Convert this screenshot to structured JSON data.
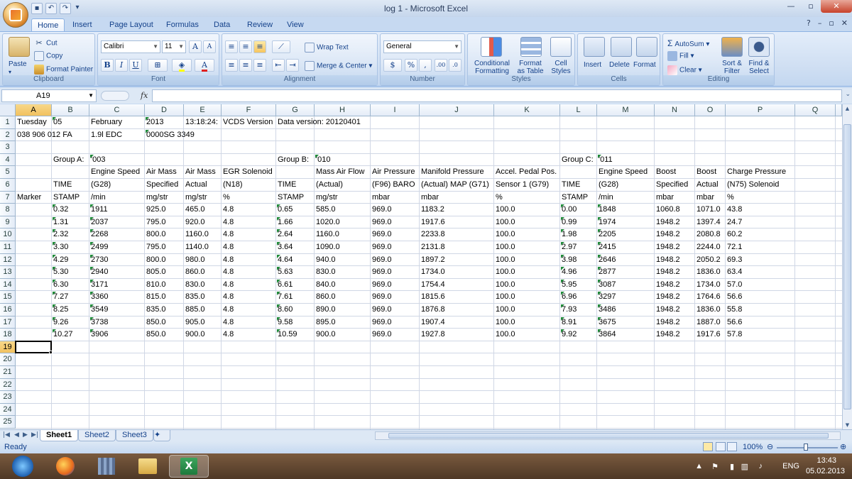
{
  "window": {
    "title": "log 1 - Microsoft Excel"
  },
  "ribbon": {
    "tabs": [
      "Home",
      "Insert",
      "Page Layout",
      "Formulas",
      "Data",
      "Review",
      "View"
    ],
    "active_tab": "Home",
    "clipboard": {
      "paste": "Paste",
      "cut": "Cut",
      "copy": "Copy",
      "format_painter": "Format Painter",
      "label": "Clipboard"
    },
    "font": {
      "name": "Calibri",
      "size": "11",
      "bold": "B",
      "italic": "I",
      "underline": "U",
      "grow": "A",
      "shrink": "A",
      "color": "A",
      "label": "Font"
    },
    "alignment": {
      "wrap": "Wrap Text",
      "merge": "Merge & Center",
      "label": "Alignment"
    },
    "number": {
      "format": "General",
      "currency": "$",
      "percent": "%",
      "comma": ",",
      "inc_dec": ".00",
      "dec_dec": ".0",
      "label": "Number"
    },
    "styles": {
      "conditional_1": "Conditional",
      "conditional_2": "Formatting",
      "format_table_1": "Format",
      "format_table_2": "as Table",
      "cell_styles_1": "Cell",
      "cell_styles_2": "Styles",
      "label": "Styles"
    },
    "cells": {
      "insert": "Insert",
      "delete": "Delete",
      "format": "Format",
      "label": "Cells"
    },
    "editing": {
      "autosum": "AutoSum",
      "fill": "Fill",
      "clear": "Clear",
      "sort_1": "Sort &",
      "sort_2": "Filter",
      "find_1": "Find &",
      "find_2": "Select",
      "label": "Editing"
    }
  },
  "formula_bar": {
    "name_box": "A19",
    "fx": "fx",
    "value": ""
  },
  "columns": [
    "A",
    "B",
    "C",
    "D",
    "E",
    "F",
    "G",
    "H",
    "I",
    "J",
    "K",
    "L",
    "M",
    "N",
    "O",
    "P",
    "Q"
  ],
  "rows": [
    "1",
    "2",
    "3",
    "4",
    "5",
    "6",
    "7",
    "8",
    "9",
    "10",
    "11",
    "12",
    "13",
    "14",
    "15",
    "16",
    "17",
    "18",
    "19",
    "20",
    "21",
    "22",
    "23",
    "24",
    "25"
  ],
  "selected_cell": {
    "col": "A",
    "row": "19"
  },
  "cells": {
    "r1": {
      "A": "Tuesday",
      "B": "05",
      "C": "February",
      "D": "2013",
      "E": "13:18:24:",
      "F": "VCDS Version",
      "G": "Data version: 20120401"
    },
    "r2": {
      "A": "038 906 012 FA",
      "C": "1.9l EDC",
      "D": "0000SG  3349"
    },
    "r4": {
      "B": "Group A:",
      "C": "'003",
      "G": "Group B:",
      "H": "'010",
      "L": "Group C:",
      "M": "'011"
    },
    "r5": {
      "C": "Engine Speed",
      "D": "Air Mass",
      "E": "Air Mass",
      "F": "EGR Solenoid",
      "H": "Mass Air Flow",
      "I": "Air Pressure",
      "J": "Manifold Pressure",
      "K": "Accel. Pedal Pos.",
      "M": "Engine Speed",
      "N": "Boost",
      "O": "Boost",
      "P": "Charge Pressure"
    },
    "r6": {
      "B": "TIME",
      "C": "(G28)",
      "D": "Specified",
      "E": "Actual",
      "F": "(N18)",
      "G": "TIME",
      "H": "(Actual)",
      "I": "(F96) BARO",
      "J": "(Actual) MAP (G71)",
      "K": "Sensor 1 (G79)",
      "L": "TIME",
      "M": "(G28)",
      "N": "Specified",
      "O": "Actual",
      "P": "(N75) Solenoid"
    },
    "r7": {
      "A": "Marker",
      "B": "STAMP",
      "C": " /min",
      "D": " mg/str",
      "E": " mg/str",
      "F": " %",
      "G": "STAMP",
      "H": " mg/str",
      "I": " mbar",
      "J": " mbar",
      "K": " %",
      "L": "STAMP",
      "M": " /min",
      "N": " mbar",
      "O": " mbar",
      "P": " %"
    }
  },
  "data_rows": [
    {
      "B": "0.32",
      "C": "1911",
      "D": "925.0",
      "E": "465.0",
      "F": "4.8",
      "G": "0.65",
      "H": "585.0",
      "I": "969.0",
      "J": "1183.2",
      "K": "100.0",
      "L": "0.00",
      "M": "1848",
      "N": "1060.8",
      "O": "1071.0",
      "P": "43.8"
    },
    {
      "B": "1.31",
      "C": "2037",
      "D": "795.0",
      "E": "920.0",
      "F": "4.8",
      "G": "1.66",
      "H": "1020.0",
      "I": "969.0",
      "J": "1917.6",
      "K": "100.0",
      "L": "0.99",
      "M": "1974",
      "N": "1948.2",
      "O": "1397.4",
      "P": "24.7"
    },
    {
      "B": "2.32",
      "C": "2268",
      "D": "800.0",
      "E": "1160.0",
      "F": "4.8",
      "G": "2.64",
      "H": "1160.0",
      "I": "969.0",
      "J": "2233.8",
      "K": "100.0",
      "L": "1.98",
      "M": "2205",
      "N": "1948.2",
      "O": "2080.8",
      "P": "60.2"
    },
    {
      "B": "3.30",
      "C": "2499",
      "D": "795.0",
      "E": "1140.0",
      "F": "4.8",
      "G": "3.64",
      "H": "1090.0",
      "I": "969.0",
      "J": "2131.8",
      "K": "100.0",
      "L": "2.97",
      "M": "2415",
      "N": "1948.2",
      "O": "2244.0",
      "P": "72.1"
    },
    {
      "B": "4.29",
      "C": "2730",
      "D": "800.0",
      "E": "980.0",
      "F": "4.8",
      "G": "4.64",
      "H": "940.0",
      "I": "969.0",
      "J": "1897.2",
      "K": "100.0",
      "L": "3.98",
      "M": "2646",
      "N": "1948.2",
      "O": "2050.2",
      "P": "69.3"
    },
    {
      "B": "5.30",
      "C": "2940",
      "D": "805.0",
      "E": "860.0",
      "F": "4.8",
      "G": "5.63",
      "H": "830.0",
      "I": "969.0",
      "J": "1734.0",
      "K": "100.0",
      "L": "4.96",
      "M": "2877",
      "N": "1948.2",
      "O": "1836.0",
      "P": "63.4"
    },
    {
      "B": "6.30",
      "C": "3171",
      "D": "810.0",
      "E": "830.0",
      "F": "4.8",
      "G": "6.61",
      "H": "840.0",
      "I": "969.0",
      "J": "1754.4",
      "K": "100.0",
      "L": "5.95",
      "M": "3087",
      "N": "1948.2",
      "O": "1734.0",
      "P": "57.0"
    },
    {
      "B": "7.27",
      "C": "3360",
      "D": "815.0",
      "E": "835.0",
      "F": "4.8",
      "G": "7.61",
      "H": "860.0",
      "I": "969.0",
      "J": "1815.6",
      "K": "100.0",
      "L": "6.96",
      "M": "3297",
      "N": "1948.2",
      "O": "1764.6",
      "P": "56.6"
    },
    {
      "B": "8.25",
      "C": "3549",
      "D": "835.0",
      "E": "885.0",
      "F": "4.8",
      "G": "8.60",
      "H": "890.0",
      "I": "969.0",
      "J": "1876.8",
      "K": "100.0",
      "L": "7.93",
      "M": "3486",
      "N": "1948.2",
      "O": "1836.0",
      "P": "55.8"
    },
    {
      "B": "9.26",
      "C": "3738",
      "D": "850.0",
      "E": "905.0",
      "F": "4.8",
      "G": "9.58",
      "H": "895.0",
      "I": "969.0",
      "J": "1907.4",
      "K": "100.0",
      "L": "8.91",
      "M": "3675",
      "N": "1948.2",
      "O": "1887.0",
      "P": "56.6"
    },
    {
      "B": "10.27",
      "C": "3906",
      "D": "850.0",
      "E": "900.0",
      "F": "4.8",
      "G": "10.59",
      "H": "900.0",
      "I": "969.0",
      "J": "1927.8",
      "K": "100.0",
      "L": "9.92",
      "M": "3864",
      "N": "1948.2",
      "O": "1917.6",
      "P": "57.8"
    }
  ],
  "sheets": [
    "Sheet1",
    "Sheet2",
    "Sheet3"
  ],
  "active_sheet": "Sheet1",
  "status": {
    "ready": "Ready",
    "zoom": "100%"
  },
  "taskbar": {
    "lang": "ENG",
    "time": "13:43",
    "date": "05.02.2013"
  },
  "colors": {
    "ribbon_blue": "#c6d9f1",
    "grid_line": "#d0d7e5",
    "selected_header": "#f8d88a",
    "error_triangle": "#1f8a3a"
  }
}
